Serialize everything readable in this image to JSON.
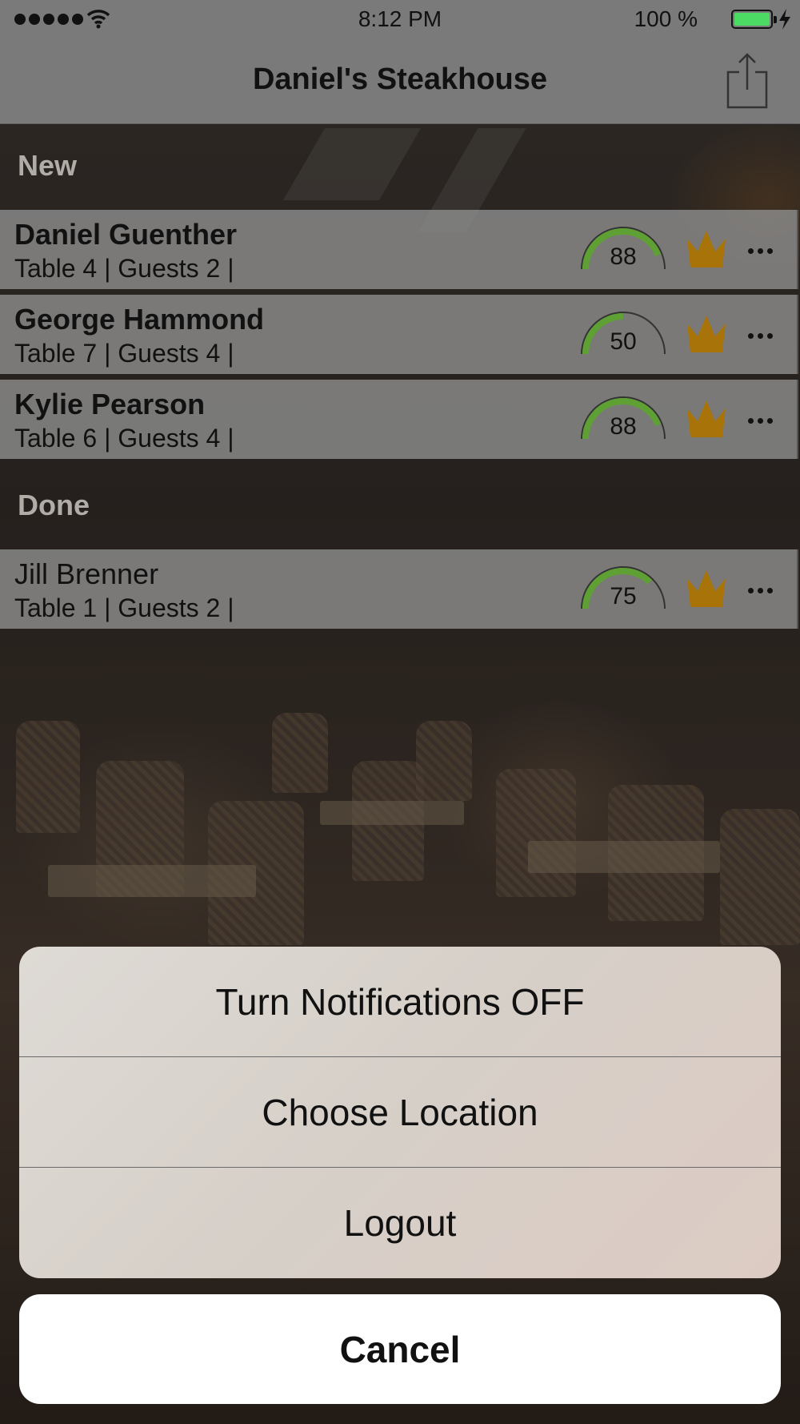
{
  "status_bar": {
    "time": "8:12 PM",
    "battery_percent": "100 %",
    "battery_level": 1.0
  },
  "nav": {
    "title": "Daniel's Steakhouse"
  },
  "sections": [
    {
      "title": "New"
    },
    {
      "title": "Done"
    }
  ],
  "rows": [
    {
      "name": "Daniel Guenther",
      "meta": "Table 4 | Guests 2 |",
      "score": "88",
      "score_value": 88
    },
    {
      "name": "George Hammond",
      "meta": "Table 7 | Guests 4 |",
      "score": "50",
      "score_value": 50
    },
    {
      "name": "Kylie Pearson",
      "meta": "Table 6 | Guests 4 |",
      "score": "88",
      "score_value": 88
    },
    {
      "name": "Jill Brenner",
      "meta": "Table 1 | Guests 2 |",
      "score": "75",
      "score_value": 75
    }
  ],
  "action_sheet": {
    "items": [
      "Turn Notifications OFF",
      "Choose Location",
      "Logout"
    ],
    "cancel": "Cancel"
  },
  "colors": {
    "gauge_fill": "#5ea033",
    "gauge_track": "#333333",
    "crown": "#a8740a",
    "battery": "#4cd964"
  },
  "icons": {
    "share": "share-icon",
    "crown": "crown-icon",
    "more": "more-icon"
  }
}
